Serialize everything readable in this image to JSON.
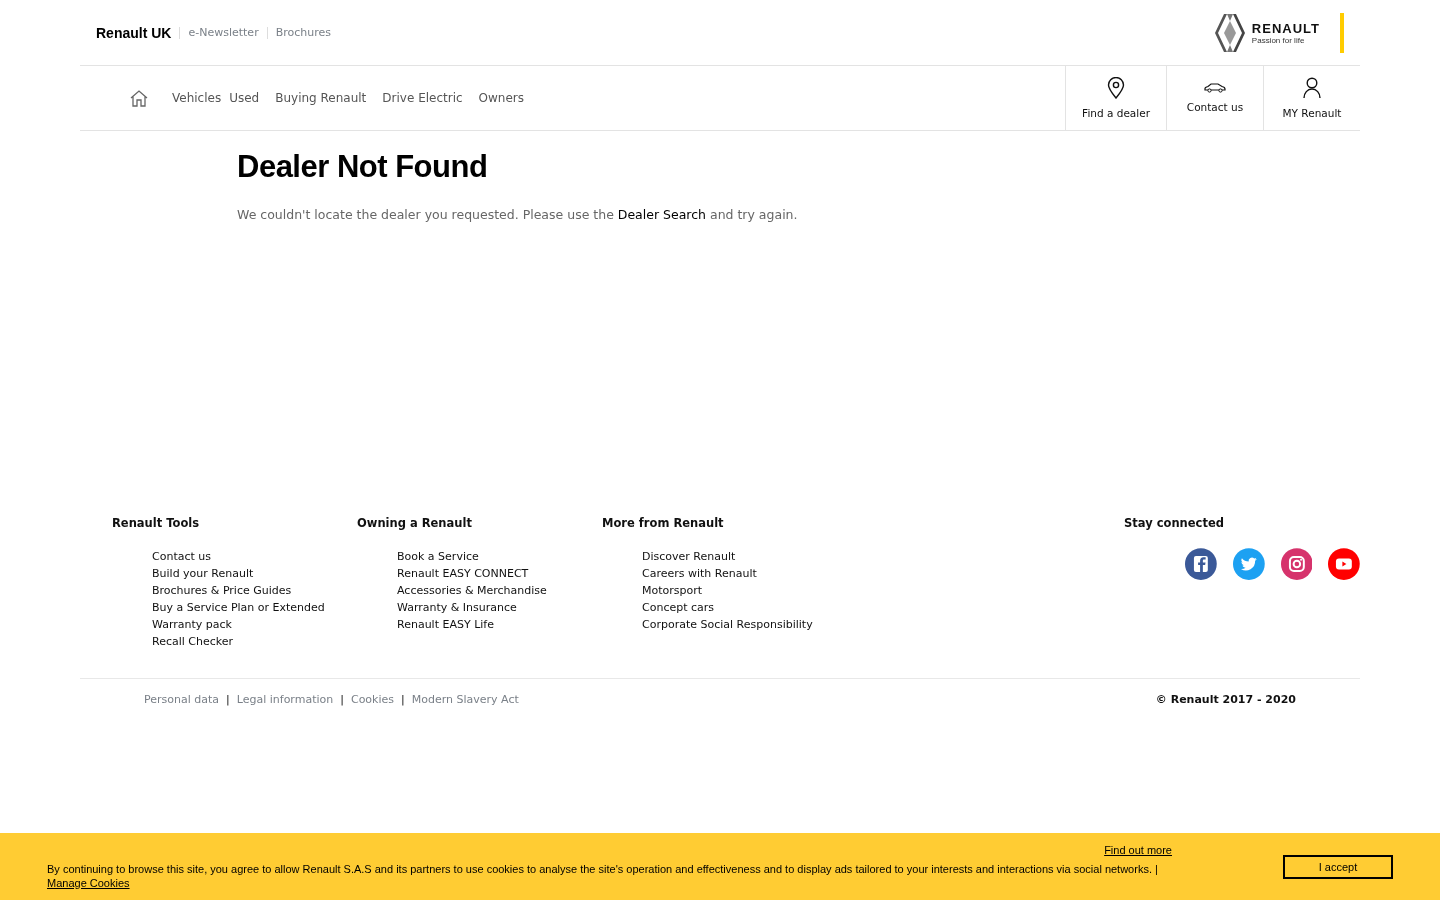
{
  "top_bar": {
    "brand": "Renault UK",
    "links": [
      "e-Newsletter",
      "Brochures"
    ],
    "logo": {
      "wordmark": "RENAULT",
      "tagline": "Passion for life"
    }
  },
  "nav": {
    "items": [
      "Vehicles",
      "Used",
      "Buying Renault",
      "Drive Electric",
      "Owners"
    ],
    "actions": [
      {
        "kind": "pin",
        "label": "Find a dealer"
      },
      {
        "kind": "car",
        "label": "Contact us"
      },
      {
        "kind": "person",
        "label": "MY Renault"
      }
    ]
  },
  "main": {
    "title": "Dealer Not Found",
    "message_before": "We couldn't locate the dealer you requested. Please use the",
    "message_link": "Dealer Search",
    "message_after": "and try again."
  },
  "footer": {
    "columns": [
      {
        "heading": "Renault Tools",
        "links": [
          "Contact us",
          "Build your Renault",
          "Brochures & Price Guides",
          "Buy a Service Plan or Extended",
          "Warranty pack",
          "Recall Checker"
        ]
      },
      {
        "heading": "Owning a Renault",
        "links": [
          "Book a Service",
          "Renault EASY CONNECT",
          "Accessories & Merchandise",
          "Warranty & Insurance",
          "Renault EASY Life"
        ]
      },
      {
        "heading": "More from Renault",
        "links": [
          "Discover Renault",
          "Careers with Renault",
          "Motorsport",
          "Concept cars",
          "Corporate Social Responsibility"
        ]
      }
    ],
    "social": {
      "heading": "Stay connected",
      "icons": [
        {
          "kind": "facebook",
          "color": "#3b5998"
        },
        {
          "kind": "twitter",
          "color": "#1da1f2"
        },
        {
          "kind": "instagram",
          "color": "#d6336c"
        },
        {
          "kind": "youtube",
          "color": "#ff0000"
        }
      ]
    },
    "legal_links": [
      "Personal data",
      "Legal information",
      "Cookies",
      "Modern Slavery Act"
    ],
    "legal_separators": [
      "|",
      "|",
      "|"
    ],
    "copyright": "© Renault 2017 - 2020"
  },
  "cookie_banner": {
    "find_out_more": "Find out more",
    "text": "By continuing to browse this site, you agree to allow Renault S.A.S and its partners to use cookies to analyse the site's operation and effectiveness and to display ads tailored to your interests and interactions via social networks. |",
    "manage_link": "Manage Cookies",
    "accept_button": "I accept"
  }
}
